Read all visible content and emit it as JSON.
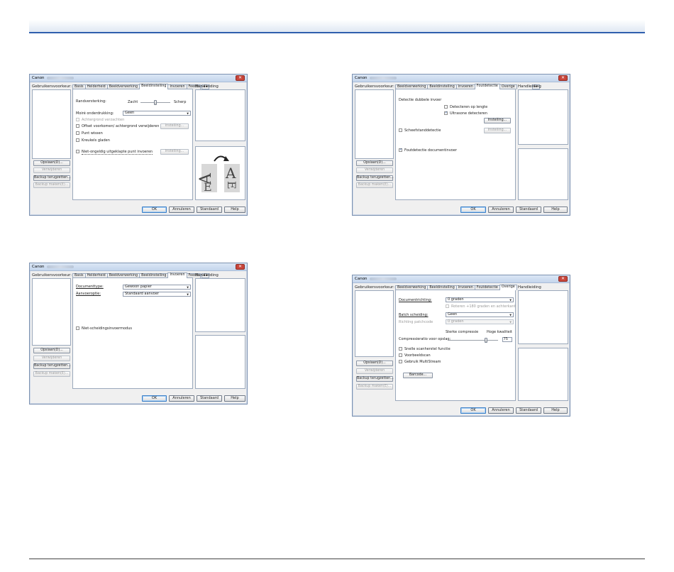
{
  "dialog_title": "Canon",
  "common": {
    "user_settings_label": "Gebruikersvoorkeur:",
    "manual_label": "Handleiding",
    "side_buttons": {
      "add": "Opslaan(D)...",
      "delete": "Verwijderen",
      "backup_restore": "Backup terugzetten...",
      "backup_make": "Backup maken(E)..."
    },
    "bottom_buttons": {
      "ok": "OK",
      "cancel": "Annuleren",
      "default": "Standaard",
      "help": "Help"
    }
  },
  "dialogs": [
    {
      "tabs": [
        "Basis",
        "Helderheid",
        "Beeldverwerking",
        "Beeldinstelling",
        "Invoeren",
        "Feedb"
      ],
      "active_tab": "Beeldinstelling",
      "content": {
        "edge_label": "Randversterking:",
        "soft_label": "Zacht",
        "sharp_label": "Scherp",
        "moire_label": "Moiré onderdrukking:",
        "moire_value": "Geen",
        "bg_smooth": "Achtergrond verzachten",
        "offset_remove": "Offset voorkomen/ achtergrond verwijderen",
        "dots_remove": "Punt wissen",
        "notch_remove": "Kreukels gladen",
        "prevent_bleed": "Niet-ongeldig uitgeklapte punt invoeren",
        "settings_btn": "Instelling...",
        "edge_level": 0.5
      }
    },
    {
      "tabs": [
        "Beeldverwerking",
        "Beeldinstelling",
        "Invoeren",
        "Foutdetectie",
        "Overige"
      ],
      "active_tab": "Foutdetectie",
      "content": {
        "double_feed_label": "Detectie dubbele invoer",
        "by_length": "Detecteren op lengte",
        "ultrasonic": "Ultrasone detecteren",
        "settings_btn": "Instelling...",
        "staple_detect": "Scheefstanddetectie",
        "doc_protection": "Foutdetectie documentinvoer"
      }
    },
    {
      "tabs": [
        "Basis",
        "Helderheid",
        "Beeldverwerking",
        "Beeldinstelling",
        "Invoeren",
        "Feedb"
      ],
      "active_tab": "Invoeren",
      "content": {
        "doc_type_label": "Documenttype:",
        "doc_type_value": "Gewoon papier",
        "feed_option_label": "Aanvoeroptie:",
        "feed_option_value": "Standaard aanvoer",
        "nonsep_feed": "Niet-scheidingsinvoermodus"
      }
    },
    {
      "tabs": [
        "Beeldverwerking",
        "Beeldinstelling",
        "Invoeren",
        "Foutdetectie",
        "Overige"
      ],
      "active_tab": "Overige",
      "content": {
        "doc_orient_label": "Documentrichting:",
        "doc_orient_value": "0 graden",
        "rotate_180": "Roteren +180 graden en achterkant",
        "batch_label": "Batch scheiding:",
        "batch_value": "Geen",
        "barcode_orient_label": "Richting patchcode",
        "barcode_orient_value": "0 graden",
        "strong_comp": "Sterke compressie",
        "high_quality": "Hoge kwaliteit",
        "comp_label": "Compressieratio voor opslag:",
        "comp_value": "75",
        "comp_level": 0.75,
        "fast_recovery": "Snelle scanherstel functie",
        "prescan": "Voorbeeldscan",
        "multistream": "Gebruik MultiStream",
        "barcode_btn": "Barcode..."
      }
    }
  ]
}
